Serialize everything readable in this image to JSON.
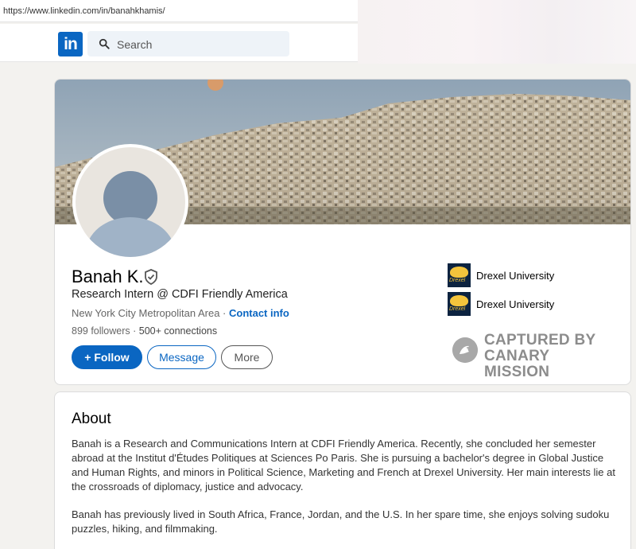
{
  "browser": {
    "url": "https://www.linkedin.com/in/banahkhamis/"
  },
  "nav": {
    "logo_text": "in",
    "search_placeholder": "Search"
  },
  "profile": {
    "name": "Banah K.",
    "headline": "Research Intern @ CDFI Friendly America",
    "location": "New York City Metropolitan Area",
    "location_separator": " · ",
    "contact_label": "Contact info",
    "followers": "899 followers",
    "connections_separator": " · ",
    "connections": "500+ connections",
    "buttons": {
      "follow": "+ Follow",
      "message": "Message",
      "more": "More"
    },
    "education": [
      {
        "name": "Drexel University",
        "logo_text": "Drexel"
      },
      {
        "name": "Drexel University",
        "logo_text": "Drexel"
      }
    ]
  },
  "watermark": {
    "line1": "CAPTURED BY",
    "line2": "CANARY MISSION"
  },
  "about": {
    "title": "About",
    "paragraph1": "Banah is a Research and Communications Intern at CDFI Friendly America. Recently, she concluded her semester abroad at the Institut d'Études Politiques at Sciences Po Paris. She is pursuing a bachelor's degree in Global Justice and Human Rights, and minors in Political Science, Marketing and French at Drexel University. Her main interests lie at the crossroads of diplomacy, justice and advocacy.",
    "paragraph2": "Banah has previously lived in South Africa, France, Jordan, and the U.S. In her spare time, she enjoys solving sudoku puzzles, hiking, and filmmaking."
  },
  "colors": {
    "linkedin_blue": "#0a66c2",
    "page_bg": "#f3f2ef"
  },
  "icons": {
    "search": "search-icon",
    "verified": "shield-check-icon",
    "watermark": "bird-icon"
  }
}
